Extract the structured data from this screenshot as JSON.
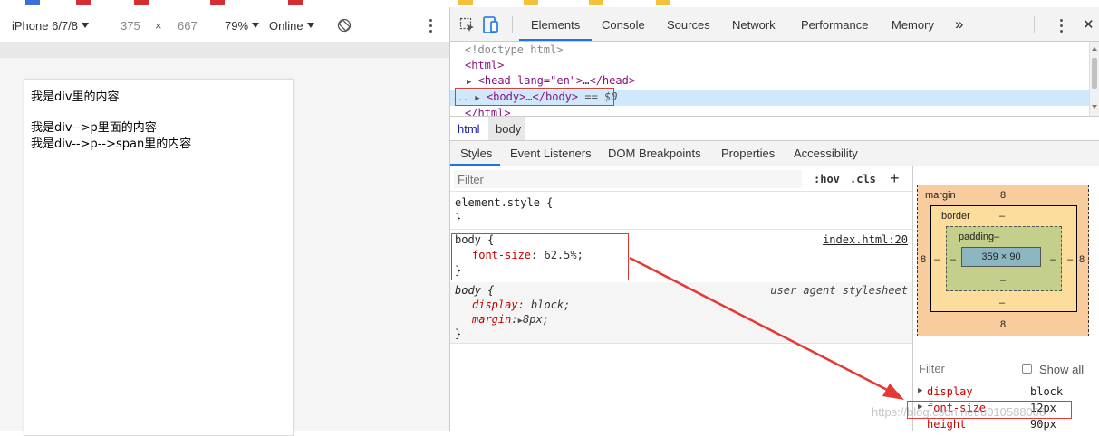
{
  "device_toolbar": {
    "device": "iPhone 6/7/8",
    "width": "375",
    "times": "×",
    "height": "667",
    "zoom": "79%",
    "throttling": "Online"
  },
  "preview": {
    "lines": [
      "我是div里的内容",
      "我是div-->p里面的内容",
      "我是div-->p-->span里的内容"
    ]
  },
  "devtools": {
    "tabs": [
      "Elements",
      "Console",
      "Sources",
      "Network",
      "Performance",
      "Memory"
    ],
    "more": "»",
    "close": "✕"
  },
  "dom": {
    "doctype": "<!doctype html>",
    "html_open": "<html>",
    "head_open": "<head lang=\"en\">",
    "head_ellipsis": "…",
    "head_close": "</head>",
    "body_open": "<body>",
    "body_ellipsis": "…",
    "body_close": "</body>",
    "body_marker": "== $0",
    "html_close": "</html>",
    "row_dots": "..."
  },
  "breadcrumbs": [
    "html",
    "body"
  ],
  "subtabs": [
    "Styles",
    "Event Listeners",
    "DOM Breakpoints",
    "Properties",
    "Accessibility"
  ],
  "styles": {
    "filter_placeholder": "Filter",
    "hov": ":hov",
    "cls": ".cls",
    "add": "+",
    "element_style": "element.style {",
    "close_brace": "}",
    "rule1": {
      "selector": "body {",
      "property": "font-size",
      "value": "62.5%;",
      "source": "index.html:20"
    },
    "rule2": {
      "selector": "body {",
      "source": "user agent stylesheet",
      "props": [
        {
          "name": "display",
          "value": "block;"
        },
        {
          "name": "margin",
          "value": "8px;"
        }
      ]
    }
  },
  "box_model": {
    "margin_label": "margin",
    "margin_top": "8",
    "margin_bottom": "8",
    "margin_left": "8",
    "margin_right": "8",
    "border_label": "border",
    "border_top": "–",
    "border_bottom": "–",
    "border_left": "–",
    "border_right": "–",
    "padding_label": "padding–",
    "padding_bottom": "–",
    "padding_left": "–",
    "padding_right": "–",
    "content": "359 × 90"
  },
  "computed": {
    "filter_placeholder": "Filter",
    "show_all": "Show all",
    "rows": [
      {
        "name": "display",
        "value": "block"
      },
      {
        "name": "font-size",
        "value": "12px"
      },
      {
        "name": "height",
        "value": "90px"
      }
    ]
  },
  "watermark": "https://blog.csdn.net/u010588008",
  "colors": {
    "accent": "#1a73e8",
    "annotation_red": "#e53935",
    "margin_box": "#f9cc9d",
    "border_box": "#fddd9b",
    "padding_box": "#c3cf8a",
    "content_box": "#8cb6c0"
  }
}
